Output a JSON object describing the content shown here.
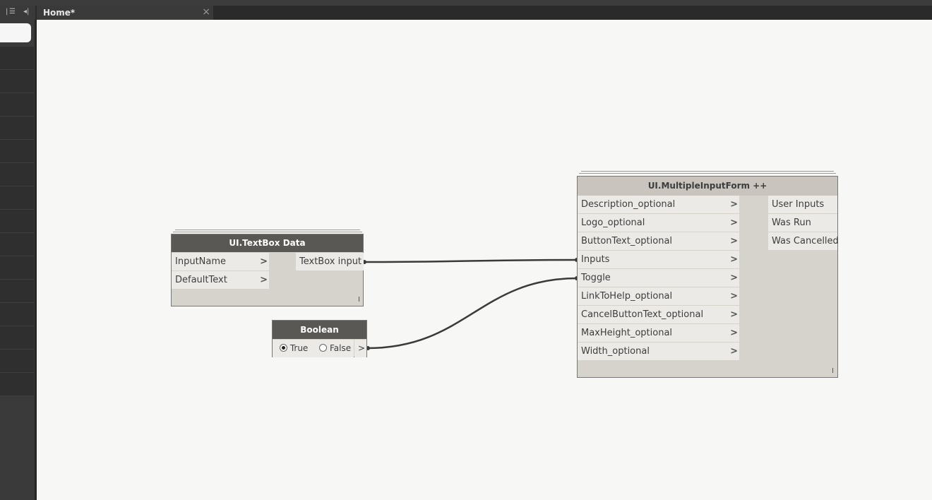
{
  "tab": {
    "title": "Home*",
    "close": "×"
  },
  "window_controls": {
    "pipe": "|",
    "menu": "☰",
    "collapse": "◂|"
  },
  "nodes": {
    "textbox": {
      "title": "UI.TextBox Data",
      "inputs": [
        "InputName",
        "DefaultText"
      ],
      "output": "TextBox input"
    },
    "boolean": {
      "title": "Boolean",
      "true_label": "True",
      "false_label": "False",
      "selected": "True",
      "output": ">"
    },
    "form": {
      "title": "UI.MultipleInputForm ++",
      "inputs": [
        "Description_optional",
        "Logo_optional",
        "ButtonText_optional",
        "Inputs",
        "Toggle",
        "LinkToHelp_optional",
        "CancelButtonText_optional",
        "MaxHeight_optional",
        "Width_optional"
      ],
      "outputs": [
        "User Inputs",
        "Was Run",
        "Was Cancelled"
      ]
    }
  },
  "colors": {
    "header_dark": "#5a5855",
    "header_light": "#c9c5be",
    "canvas": "#f7f7f5",
    "wire": "#3a3a3a"
  }
}
